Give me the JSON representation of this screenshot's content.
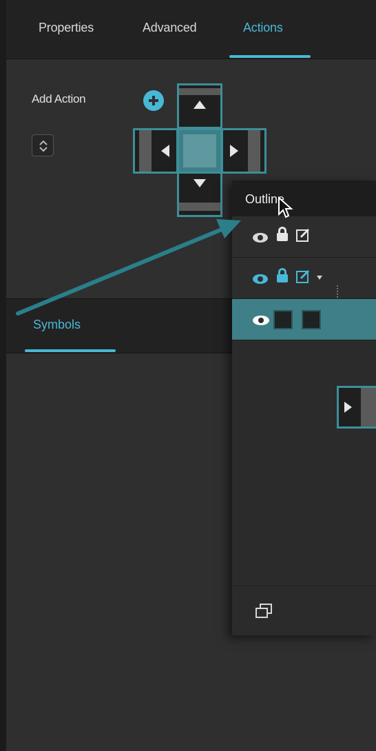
{
  "tabs": [
    {
      "label": "Properties",
      "active": false
    },
    {
      "label": "Advanced",
      "active": false
    },
    {
      "label": "Actions",
      "active": true
    }
  ],
  "actions": {
    "add_action_label": "Add Action",
    "add_icon": "plus-circle-icon",
    "stepper_icon": "up-down-chevron-icon"
  },
  "dpad": {
    "up_icon": "arrow-up-icon",
    "down_icon": "arrow-down-icon",
    "left_icon": "arrow-left-icon",
    "right_icon": "arrow-right-icon"
  },
  "symbols_panel": {
    "tab_label": "Symbols"
  },
  "outline": {
    "title": "Outline",
    "rows": [
      {
        "icons": [
          "eye-icon",
          "lock-icon",
          "edit-icon"
        ],
        "selected": false
      },
      {
        "icons": [
          "eye-icon",
          "lock-icon",
          "edit-icon",
          "disclosure-triangle-icon"
        ],
        "selected": false
      },
      {
        "icons": [
          "eye-icon",
          "checkbox-icon",
          "checkbox-icon"
        ],
        "selected": true
      }
    ],
    "footer_icon": "duplicate-windows-icon"
  },
  "colors": {
    "accent": "#49b8d6",
    "teal_border": "#3d8f99",
    "selected_row": "#3f7f88",
    "panel_bg": "#2f2f2f",
    "header_bg": "#222222"
  }
}
